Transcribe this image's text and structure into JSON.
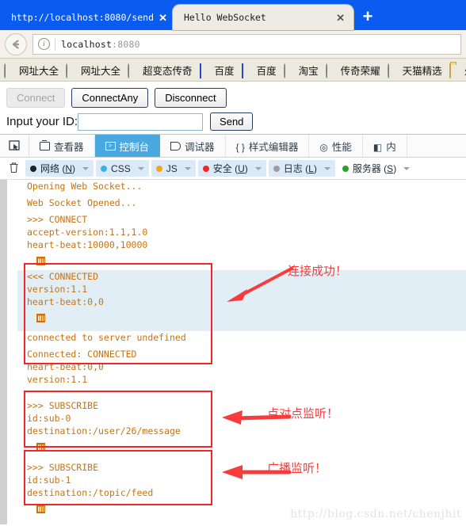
{
  "browser": {
    "tabs": [
      {
        "title": "http://localhost:8080/send",
        "close": "✕",
        "active": false
      },
      {
        "title": "Hello WebSocket",
        "close": "✕",
        "active": true
      }
    ],
    "new_tab_label": "+",
    "back_icon": "←",
    "info_icon": "i",
    "url_host": "localhost",
    "url_port": ":8080",
    "bookmarks": [
      {
        "label": "网址大全",
        "icon": "globe-icon"
      },
      {
        "label": "网址大全",
        "icon": "globe-icon"
      },
      {
        "label": "超变态传奇",
        "icon": "globe-icon"
      },
      {
        "label": "百度",
        "icon": "baidu-icon"
      },
      {
        "label": "百度",
        "icon": "baidu-icon"
      },
      {
        "label": "淘宝",
        "icon": "globe-icon"
      },
      {
        "label": "传奇荣耀",
        "icon": "globe-icon"
      },
      {
        "label": "天猫精选",
        "icon": "globe-icon"
      },
      {
        "label": "火",
        "icon": "folder-icon"
      }
    ]
  },
  "page": {
    "connect_label": "Connect",
    "connect_any_label": "ConnectAny",
    "disconnect_label": "Disconnect",
    "id_label": "Input your ID:",
    "id_value": "",
    "id_placeholder": "",
    "send_label": "Send"
  },
  "devtools": {
    "picker_icon": "element-picker-icon",
    "tabs": [
      {
        "label": "查看器",
        "icon": "inspector-icon",
        "selected": false
      },
      {
        "label": "控制台",
        "icon": "console-icon",
        "selected": true
      },
      {
        "label": "调试器",
        "icon": "debugger-icon",
        "selected": false
      },
      {
        "label": "样式编辑器",
        "icon": "braces-icon",
        "selected": false
      },
      {
        "label": "性能",
        "icon": "performance-icon",
        "selected": false
      },
      {
        "label": "内",
        "icon": "responsive-icon",
        "selected": false
      }
    ],
    "clear_icon": "trash-icon",
    "filters": [
      {
        "label": "网络",
        "key": "N",
        "color": "#222222",
        "active": true
      },
      {
        "label": "CSS",
        "key": "",
        "color": "#33b5e5",
        "active": true
      },
      {
        "label": "JS",
        "key": "",
        "color": "#f5a623",
        "active": true
      },
      {
        "label": "安全",
        "key": "U",
        "color": "#ef2929",
        "active": true
      },
      {
        "label": "日志",
        "key": "L",
        "color": "#9e9e9e",
        "active": true
      },
      {
        "label": "服务器",
        "key": "S",
        "color": "#2ca02c",
        "active": false
      }
    ]
  },
  "console": {
    "text_color": "#c8730f",
    "highlight_bg": "#e2eef6",
    "blocks": [
      {
        "lines": [
          "Opening Web Socket..."
        ],
        "gap_after": true
      },
      {
        "lines": [
          "Web Socket Opened..."
        ],
        "gap_after": true
      },
      {
        "lines": [
          ">>> CONNECT",
          "accept-version:1.1,1.0",
          "heart-beat:10000,10000"
        ],
        "gap_after": true
      },
      {
        "icon": "grid-icon"
      },
      {
        "lines": [
          "<<< CONNECTED",
          "version:1.1",
          "heart-beat:0,0"
        ],
        "highlight": true
      },
      {
        "icon": "grid-icon",
        "highlight": true
      },
      {
        "lines": [
          "connected to server undefined"
        ],
        "gap_after": true
      },
      {
        "lines": [
          "Connected: CONNECTED",
          "heart-beat:0,0",
          "version:1.1"
        ],
        "gap_after": true
      },
      {
        "lines": [
          ">>> SUBSCRIBE",
          "id:sub-0",
          "destination:/user/26/message"
        ],
        "gap_after": true
      },
      {
        "icon": "grid-icon"
      },
      {
        "lines": [
          ">>> SUBSCRIBE",
          "id:sub-1",
          "destination:/topic/feed"
        ],
        "gap_after": true
      },
      {
        "icon": "grid-icon"
      }
    ]
  },
  "annotations": [
    {
      "text": "连接成功！",
      "color": "#fa3b3b"
    },
    {
      "text": "点对点监听！",
      "color": "#fa3b3b"
    },
    {
      "text": "广播监听！",
      "color": "#fa3b3b"
    }
  ],
  "watermark": "http://blog.csdn.net/chenjhit"
}
